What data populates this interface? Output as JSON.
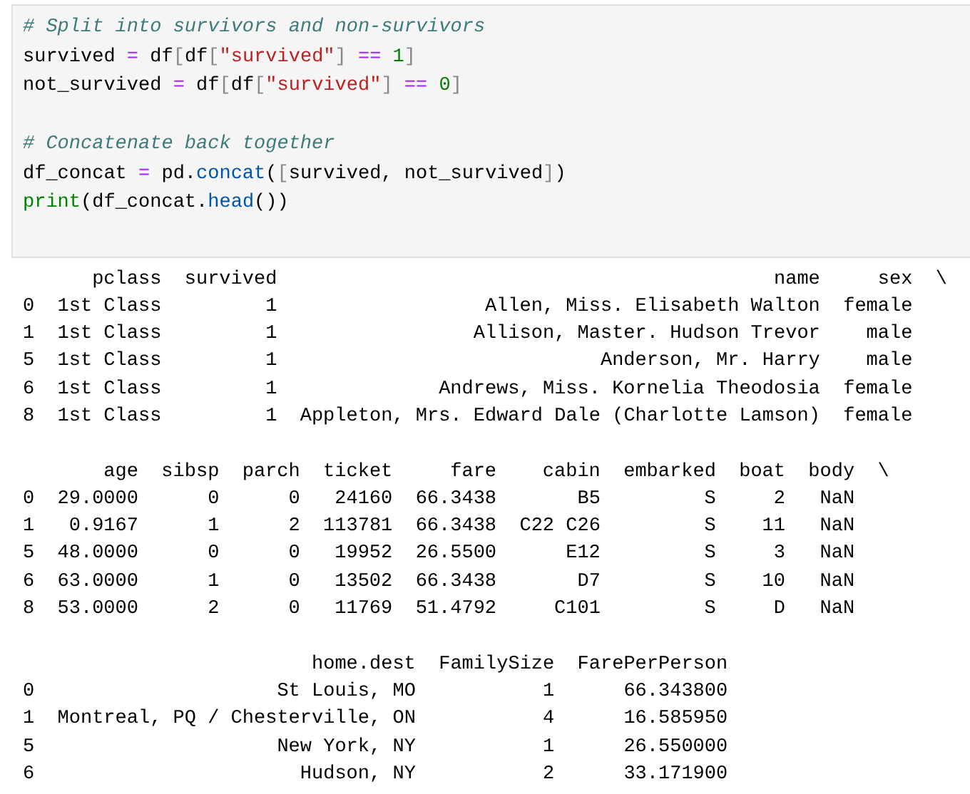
{
  "code_cell": {
    "groups": [
      {
        "lines": [
          [
            {
              "t": "# Split into survivors and non-survivors",
              "kind": "comment"
            }
          ],
          [
            {
              "t": "survived ",
              "kind": "name"
            },
            {
              "t": "=",
              "kind": "op"
            },
            {
              "t": " df",
              "kind": "name"
            },
            {
              "t": "[",
              "kind": "bracket"
            },
            {
              "t": "df",
              "kind": "name"
            },
            {
              "t": "[",
              "kind": "bracket"
            },
            {
              "t": "\"survived\"",
              "kind": "string"
            },
            {
              "t": "]",
              "kind": "bracket"
            },
            {
              "t": " == ",
              "kind": "op"
            },
            {
              "t": "1",
              "kind": "number"
            },
            {
              "t": "]",
              "kind": "bracket"
            }
          ],
          [
            {
              "t": "not_survived ",
              "kind": "name"
            },
            {
              "t": "=",
              "kind": "op"
            },
            {
              "t": " df",
              "kind": "name"
            },
            {
              "t": "[",
              "kind": "bracket"
            },
            {
              "t": "df",
              "kind": "name"
            },
            {
              "t": "[",
              "kind": "bracket"
            },
            {
              "t": "\"survived\"",
              "kind": "string"
            },
            {
              "t": "]",
              "kind": "bracket"
            },
            {
              "t": " == ",
              "kind": "op"
            },
            {
              "t": "0",
              "kind": "number"
            },
            {
              "t": "]",
              "kind": "bracket"
            }
          ]
        ]
      },
      {
        "lines": [
          [
            {
              "t": "# Concatenate back together",
              "kind": "comment"
            }
          ],
          [
            {
              "t": "df_concat ",
              "kind": "name"
            },
            {
              "t": "=",
              "kind": "op"
            },
            {
              "t": " pd.",
              "kind": "name"
            },
            {
              "t": "concat",
              "kind": "attr"
            },
            {
              "t": "(",
              "kind": "name"
            },
            {
              "t": "[",
              "kind": "bracket"
            },
            {
              "t": "survived, not_survived",
              "kind": "name"
            },
            {
              "t": "]",
              "kind": "bracket"
            },
            {
              "t": ")",
              "kind": "name"
            }
          ],
          [
            {
              "t": "print",
              "kind": "builtin"
            },
            {
              "t": "(df_concat.",
              "kind": "name"
            },
            {
              "t": "head",
              "kind": "attr"
            },
            {
              "t": "())",
              "kind": "name"
            }
          ]
        ]
      }
    ]
  },
  "output": {
    "blocks": [
      {
        "index": [
          "0",
          "1",
          "5",
          "6",
          "8"
        ],
        "continuation": "\\",
        "columns": [
          {
            "header": "pclass",
            "cells": [
              "1st Class",
              "1st Class",
              "1st Class",
              "1st Class",
              "1st Class"
            ]
          },
          {
            "header": "survived",
            "cells": [
              "1",
              "1",
              "1",
              "1",
              "1"
            ]
          },
          {
            "header": "name",
            "cells": [
              "Allen, Miss. Elisabeth Walton",
              "Allison, Master. Hudson Trevor",
              "Anderson, Mr. Harry",
              "Andrews, Miss. Kornelia Theodosia",
              "Appleton, Mrs. Edward Dale (Charlotte Lamson)"
            ]
          },
          {
            "header": "sex",
            "cells": [
              "female",
              "male",
              "male",
              "female",
              "female"
            ]
          }
        ]
      },
      {
        "index": [
          "0",
          "1",
          "5",
          "6",
          "8"
        ],
        "continuation": "\\",
        "columns": [
          {
            "header": "age",
            "cells": [
              "29.0000",
              "0.9167",
              "48.0000",
              "63.0000",
              "53.0000"
            ]
          },
          {
            "header": "sibsp",
            "cells": [
              "0",
              "1",
              "0",
              "1",
              "2"
            ]
          },
          {
            "header": "parch",
            "cells": [
              "0",
              "2",
              "0",
              "0",
              "0"
            ]
          },
          {
            "header": "ticket",
            "cells": [
              "24160",
              "113781",
              "19952",
              "13502",
              "11769"
            ]
          },
          {
            "header": "fare",
            "cells": [
              "66.3438",
              "66.3438",
              "26.5500",
              "66.3438",
              "51.4792"
            ]
          },
          {
            "header": "cabin",
            "cells": [
              "B5",
              "C22 C26",
              "E12",
              "D7",
              "C101"
            ]
          },
          {
            "header": "embarked",
            "cells": [
              "S",
              "S",
              "S",
              "S",
              "S"
            ]
          },
          {
            "header": "boat",
            "cells": [
              "2",
              "11",
              "3",
              "10",
              "D"
            ]
          },
          {
            "header": "body",
            "cells": [
              "NaN",
              "NaN",
              "NaN",
              "NaN",
              "NaN"
            ]
          }
        ]
      },
      {
        "index": [
          "0",
          "1",
          "5",
          "6"
        ],
        "columns": [
          {
            "header": "home.dest",
            "cells": [
              "St Louis, MO",
              "Montreal, PQ / Chesterville, ON",
              "New York, NY",
              "Hudson, NY"
            ]
          },
          {
            "header": "FamilySize",
            "cells": [
              "1",
              "4",
              "1",
              "2"
            ]
          },
          {
            "header": "FarePerPerson",
            "cells": [
              "66.343800",
              "16.585950",
              "26.550000",
              "33.171900"
            ]
          }
        ]
      }
    ]
  }
}
